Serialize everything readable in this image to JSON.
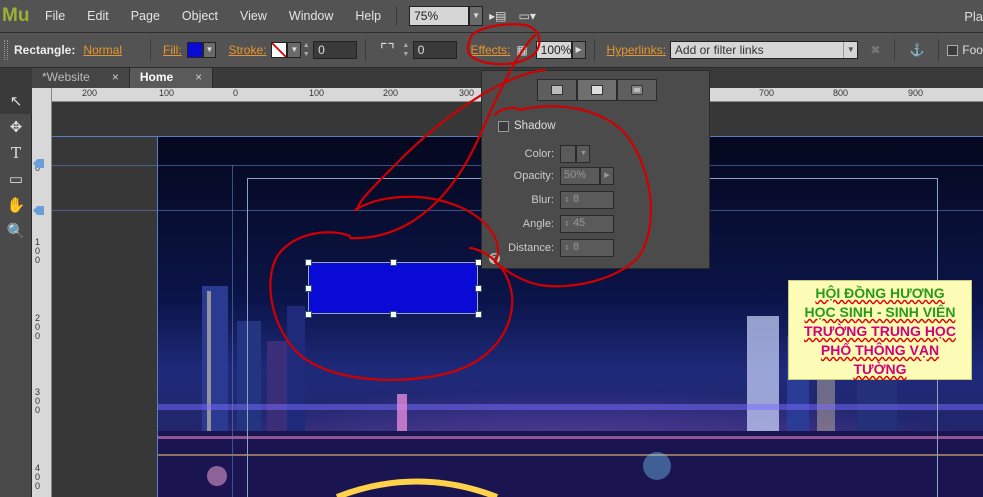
{
  "app": {
    "logo": "Mu"
  },
  "menu": [
    "File",
    "Edit",
    "Page",
    "Object",
    "View",
    "Window",
    "Help"
  ],
  "zoom": "75%",
  "right_cut": "Pla",
  "toolbar": {
    "object_type": "Rectangle:",
    "style": "Normal",
    "fill_label": "Fill:",
    "fill_color": "#0a0ad6",
    "stroke_label": "Stroke:",
    "stroke_value": "0",
    "corner_value": "0",
    "effects_label": "Effects:",
    "opacity": "100%",
    "hyperlinks_label": "Hyperlinks:",
    "hyperlinks_placeholder": "Add or filter links",
    "footer_cut": "Foo"
  },
  "tabs": [
    {
      "label": "*Website",
      "active": false
    },
    {
      "label": "Home",
      "active": true
    }
  ],
  "tab_close": "×",
  "ruler_h": [
    "200",
    "100",
    "0",
    "100",
    "200",
    "300",
    "700",
    "800",
    "900"
  ],
  "ruler_v": [
    "0",
    "100",
    "200",
    "300",
    "400"
  ],
  "effects_panel": {
    "shadow_label": "Shadow",
    "fields": [
      {
        "label": "Color:",
        "value": ""
      },
      {
        "label": "Opacity:",
        "value": "50%"
      },
      {
        "label": "Blur:",
        "value": "8"
      },
      {
        "label": "Angle:",
        "value": "45"
      },
      {
        "label": "Distance:",
        "value": "8"
      }
    ],
    "help": "?"
  },
  "note": {
    "lines": [
      "HỘI ĐỒNG HƯƠNG",
      "HỌC SINH - SINH VIÊN",
      "TRƯỜNG TRUNG HỌC",
      "PHỔ THÔNG VẠN",
      "TƯỜNG"
    ]
  },
  "icons": [
    "select-icon",
    "crop-icon",
    "text-icon",
    "rectangle-icon",
    "hand-icon",
    "zoom-icon",
    "anchor-icon",
    "close-icon"
  ],
  "colors": {
    "accent": "#e8962d",
    "annotation": "#d00000",
    "shape_fill": "#0a0ad6"
  }
}
